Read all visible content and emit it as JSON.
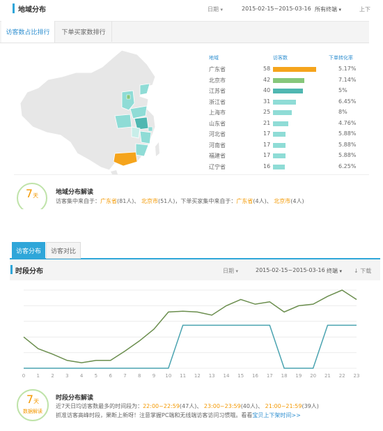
{
  "top": {
    "title": "地域分布",
    "filter_date_label": "日期",
    "date_range": "2015-02-15~2015-03-16",
    "device_select": "所有终端",
    "download_label": "上下",
    "tabs": [
      "访客数占比排行",
      "下单买家数排行"
    ],
    "table": {
      "headers": [
        "地域",
        "访客数",
        "下单转化率"
      ],
      "rows": [
        {
          "region": "广东省",
          "visitors": "58",
          "rate": "5.17%",
          "value": 58,
          "color": "#f5a41c"
        },
        {
          "region": "北京市",
          "visitors": "42",
          "rate": "7.14%",
          "value": 42,
          "color": "#86c77a"
        },
        {
          "region": "江苏省",
          "visitors": "40",
          "rate": "5%",
          "value": 40,
          "color": "#4fb7b1"
        },
        {
          "region": "浙江省",
          "visitors": "31",
          "rate": "6.45%",
          "value": 31,
          "color": "#8fdcd6"
        },
        {
          "region": "上海市",
          "visitors": "25",
          "rate": "8%",
          "value": 25,
          "color": "#8fdcd6"
        },
        {
          "region": "山东省",
          "visitors": "21",
          "rate": "4.76%",
          "value": 21,
          "color": "#8fdcd6"
        },
        {
          "region": "河北省",
          "visitors": "17",
          "rate": "5.88%",
          "value": 17,
          "color": "#8fdcd6"
        },
        {
          "region": "河南省",
          "visitors": "17",
          "rate": "5.88%",
          "value": 17,
          "color": "#8fdcd6"
        },
        {
          "region": "福建省",
          "visitors": "17",
          "rate": "5.88%",
          "value": 17,
          "color": "#8fdcd6"
        },
        {
          "region": "辽宁省",
          "visitors": "16",
          "rate": "6.25%",
          "value": 16,
          "color": "#8fdcd6"
        }
      ]
    },
    "interpretation": {
      "badge_number": "7",
      "badge_unit": "天",
      "title": "地域分布解读",
      "prefix": "访客集中来自于：",
      "v1": "广东省",
      "v1c": "(81人)、",
      "v2": "北京市",
      "v2c": "(51人)，下单买家集中来自于：",
      "b1": "广东省",
      "b1c": "(4人)、",
      "b2": "北京市",
      "b2c": "(4人)"
    }
  },
  "bottom": {
    "tabs": [
      "访客分布",
      "访客对比"
    ],
    "title": "时段分布",
    "filter_date_label": "日期",
    "date_range": "2015-02-15~2015-03-16",
    "device_select": "终端",
    "download_label": "下载",
    "interpretation": {
      "badge_number": "7",
      "badge_unit": "天",
      "badge_caption": "数据解读",
      "title": "时段分布解读",
      "line1_prefix": "近7天日均访客数最多的时间段为：",
      "s1": "22:00~22:59",
      "s1c": "(47人)、",
      "s2": "23:00~23:59",
      "s2c": "(40人)、",
      "s3": "21:00~21:59",
      "s3c": "(39人)",
      "line2_prefix": "抓准访客高峰时段，果断上新呀！注意掌握PC端和无线端访客访问习惯哦。看看",
      "line2_link": "宝贝上下架时间>>"
    }
  },
  "chart_data": {
    "type": "line",
    "categories": [
      "0",
      "1",
      "2",
      "3",
      "4",
      "5",
      "6",
      "7",
      "8",
      "9",
      "10",
      "11",
      "12",
      "13",
      "14",
      "15",
      "16",
      "17",
      "18",
      "19",
      "20",
      "21",
      "22",
      "23"
    ],
    "ylim": [
      0,
      100
    ],
    "grid": true,
    "series": [
      {
        "color": "#6b8e4e",
        "values": [
          40,
          25,
          18,
          10,
          7,
          10,
          10,
          22,
          35,
          50,
          72,
          73,
          72,
          68,
          80,
          88,
          82,
          85,
          72,
          80,
          82,
          92,
          100,
          88
        ]
      },
      {
        "color": "#4aa3b0",
        "values": [
          0,
          0,
          0,
          0,
          0,
          0,
          0,
          0,
          0,
          0,
          0,
          55,
          55,
          55,
          55,
          55,
          55,
          55,
          0,
          0,
          0,
          55,
          55,
          55
        ]
      }
    ]
  }
}
